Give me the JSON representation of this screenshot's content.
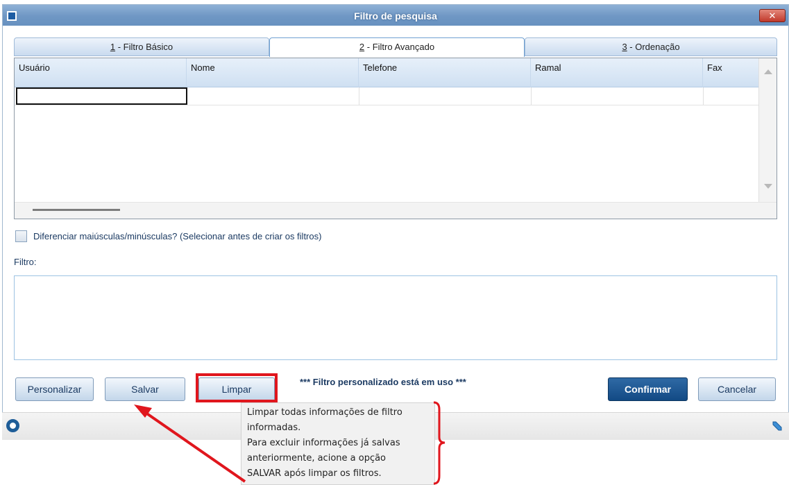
{
  "window": {
    "title": "Filtro de pesquisa",
    "close_label": "✕"
  },
  "tabs": [
    {
      "hotkey": "1",
      "label": " - Filtro Básico"
    },
    {
      "hotkey": "2",
      "label": " - Filtro Avançado",
      "active": true
    },
    {
      "hotkey": "3",
      "label": " - Ordenação"
    }
  ],
  "grid": {
    "columns": [
      "Usuário",
      "Nome",
      "Telefone",
      "Ramal",
      "Fax"
    ],
    "rows": [
      [
        "",
        "",
        "",
        "",
        ""
      ]
    ]
  },
  "case_option": {
    "label": "Diferenciar maiúsculas/minúsculas? (Selecionar antes de criar os filtros)",
    "checked": false
  },
  "filter": {
    "label": "Filtro:",
    "value": ""
  },
  "buttons": {
    "personalize": "Personalizar",
    "save": "Salvar",
    "clear": "Limpar",
    "confirm": "Confirmar",
    "cancel": "Cancelar"
  },
  "status_message": "*** Filtro personalizado está em uso ***",
  "tooltip": {
    "lines": [
      "Limpar todas informações de filtro",
      "informadas.",
      "Para excluir informações já salvas",
      "anteriormente, acione a opção",
      "SALVAR após limpar os filtros."
    ]
  },
  "colors": {
    "titlebar": "#6f97c4",
    "primary_button": "#124a84",
    "annotation_red": "#e0161d"
  }
}
